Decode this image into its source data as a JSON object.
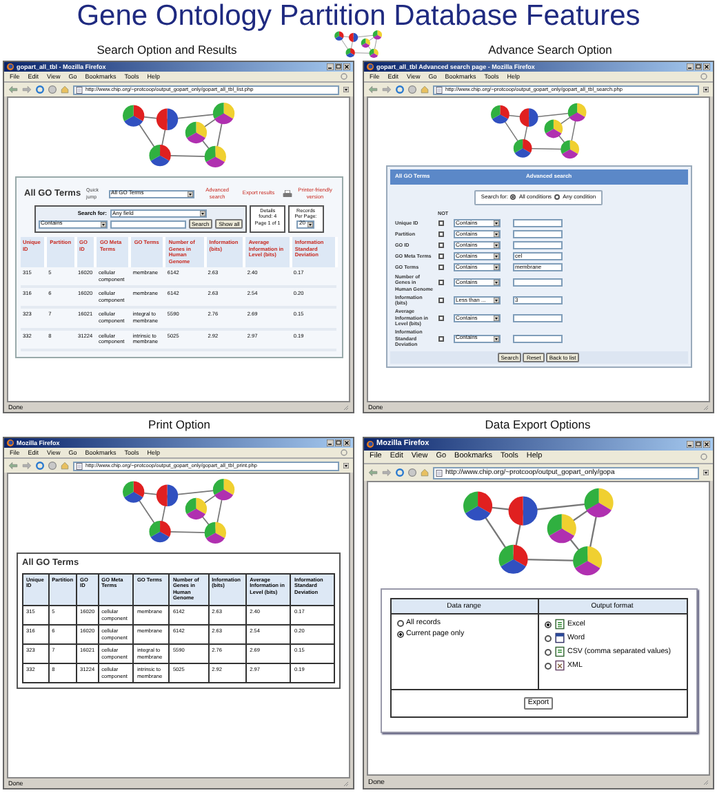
{
  "title": "Gene Ontology Partition Database Features",
  "panels": [
    {
      "kind": "results",
      "caption": "Search Option and Results",
      "window": {
        "title": "gopart_all_tbl - Mozilla Firefox",
        "menu": [
          "File",
          "Edit",
          "View",
          "Go",
          "Bookmarks",
          "Tools",
          "Help"
        ],
        "url": "http://www.chip.org/~protcoop/output_gopart_only/gopart_all_tbl_list.php",
        "status": "Done"
      },
      "heading": "All GO Terms",
      "quick_jump": {
        "label": "Quick jump",
        "value": "All GO Terms"
      },
      "links": [
        "Advanced search",
        "Export results"
      ],
      "print_link": "Printer-friendly version",
      "search": {
        "label": "Search for:",
        "field": "Any field",
        "operator": "Contains",
        "buttons": [
          "Search",
          "Show all"
        ]
      },
      "details": "Details found: 4 Page 1 of 1",
      "per_page": {
        "label": "Records Per Page:",
        "value": "20"
      },
      "table": {
        "columns": [
          "Unique ID",
          "Partition",
          "GO ID",
          "GO Meta Terms",
          "GO Terms",
          "Number of Genes in Human Genome",
          "Information (bits)",
          "Average Information in Level (bits)",
          "Information Standard Deviation"
        ],
        "rows": [
          [
            "315",
            "5",
            "16020",
            "cellular component",
            "membrane",
            "6142",
            "2.63",
            "2.40",
            "0.17"
          ],
          [
            "316",
            "6",
            "16020",
            "cellular component",
            "membrane",
            "6142",
            "2.63",
            "2.54",
            "0.20"
          ],
          [
            "323",
            "7",
            "16021",
            "cellular component",
            "integral to membrane",
            "5590",
            "2.76",
            "2.69",
            "0.15"
          ],
          [
            "332",
            "8",
            "31224",
            "cellular component",
            "intrinsic to membrane",
            "5025",
            "2.92",
            "2.97",
            "0.19"
          ]
        ]
      }
    },
    {
      "kind": "advanced",
      "caption": "Advance Search Option",
      "window": {
        "title": "gopart_all_tbl Advanced search page - Mozilla Firefox",
        "menu": [
          "File",
          "Edit",
          "View",
          "Go",
          "Bookmarks",
          "Tools",
          "Help"
        ],
        "url": "http://www.chip.org/~protcoop/output_gopart_only/gopart_all_tbl_search.php",
        "status": "Done"
      },
      "header": {
        "left": "All GO Terms",
        "center": "Advanced search"
      },
      "match": {
        "label": "Search for:",
        "options": [
          {
            "label": "All conditions",
            "selected": true
          },
          {
            "label": "Any condition",
            "selected": false
          }
        ]
      },
      "not_label": "NOT",
      "fields": [
        {
          "label": "Unique ID",
          "checked": false,
          "operator": "Contains"
        },
        {
          "label": "Partition",
          "checked": false,
          "operator": "Contains"
        },
        {
          "label": "GO ID",
          "checked": false,
          "operator": "Contains"
        },
        {
          "label": "GO Meta Terms",
          "checked": false,
          "operator": "Contains",
          "value": "cel"
        },
        {
          "label": "GO Terms",
          "checked": false,
          "operator": "Contains",
          "value": "membrane"
        },
        {
          "label": "Number of Genes in Human Genome",
          "checked": false,
          "operator": "Contains"
        },
        {
          "label": "Information (bits)",
          "checked": false,
          "operator": "Less than ...",
          "value": "3"
        },
        {
          "label": "Average Information in Level (bits)",
          "checked": false,
          "operator": "Contains"
        },
        {
          "label": "Information Standard Deviation",
          "checked": false,
          "operator": "Contains"
        }
      ],
      "buttons": [
        "Search",
        "Reset",
        "Back to list"
      ]
    },
    {
      "kind": "print",
      "caption": "Print Option",
      "window": {
        "title": "Mozilla Firefox",
        "menu": [
          "File",
          "Edit",
          "View",
          "Go",
          "Bookmarks",
          "Tools",
          "Help"
        ],
        "url": "http://www.chip.org/~protcoop/output_gopart_only/gopart_all_tbl_print.php",
        "status": "Done"
      },
      "heading": "All GO Terms",
      "table": {
        "columns": [
          "Unique ID",
          "Partition",
          "GO ID",
          "GO Meta Terms",
          "GO Terms",
          "Number of Genes in Human Genome",
          "Information (bits)",
          "Average Information in Level (bits)",
          "Information Standard Deviation"
        ],
        "rows": [
          [
            "315",
            "5",
            "16020",
            "cellular component",
            "membrane",
            "6142",
            "2.63",
            "2.40",
            "0.17"
          ],
          [
            "316",
            "6",
            "16020",
            "cellular component",
            "membrane",
            "6142",
            "2.63",
            "2.54",
            "0.20"
          ],
          [
            "323",
            "7",
            "16021",
            "cellular component",
            "integral to membrane",
            "5590",
            "2.76",
            "2.69",
            "0.15"
          ],
          [
            "332",
            "8",
            "31224",
            "cellular component",
            "intrinsic to membrane",
            "5025",
            "2.92",
            "2.97",
            "0.19"
          ]
        ]
      }
    },
    {
      "kind": "export",
      "caption": "Data Export Options",
      "window": {
        "title": "Mozilla Firefox",
        "menu": [
          "File",
          "Edit",
          "View",
          "Go",
          "Bookmarks",
          "Tools",
          "Help"
        ],
        "url": "http://www.chip.org/~protcoop/output_gopart_only/gopa",
        "status": "Done"
      },
      "range": {
        "header": "Data range",
        "options": [
          {
            "label": "All records",
            "selected": false
          },
          {
            "label": "Current page only",
            "selected": true
          }
        ]
      },
      "format": {
        "header": "Output format",
        "options": [
          {
            "label": "Excel",
            "kind": "excel",
            "selected": true
          },
          {
            "label": "Word",
            "kind": "word",
            "selected": false
          },
          {
            "label": "CSV (comma separated values)",
            "kind": "csv",
            "selected": false
          },
          {
            "label": "XML",
            "kind": "xml",
            "selected": false
          }
        ]
      },
      "button": "Export"
    }
  ]
}
